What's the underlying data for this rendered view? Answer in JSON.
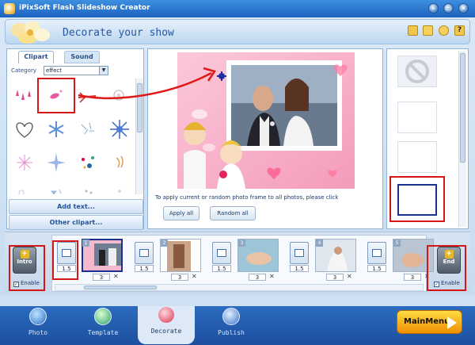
{
  "window": {
    "title": "iPixSoft Flash Slideshow Creator"
  },
  "header": {
    "title": "Decorate your show",
    "icons": [
      "folder-icon",
      "save-icon",
      "user-icon",
      "help-icon"
    ]
  },
  "left_panel": {
    "tabs": [
      {
        "label": "Clipart",
        "active": true
      },
      {
        "label": "Sound",
        "active": false
      }
    ],
    "category_label": "Category",
    "category_value": "effect",
    "clip_icons": [
      "drops-clip",
      "heart-confetti-clip",
      "arrow-clip",
      "flower-clip",
      "heart-outline-clip",
      "snowflake-clip",
      "sparkle-clip",
      "star-burst-clip",
      "firework-clip",
      "sparkle-star-clip",
      "confetti-clip",
      "leaf-clip",
      "bubbles-clip",
      "shapes-clip",
      "dots-clip",
      "drops2-clip"
    ],
    "add_text": "Add text...",
    "other_clipart": "Other clipart..."
  },
  "preview": {
    "hint": "To apply current or random photo frame  to all photos, please click",
    "apply_all": "Apply all",
    "random_all": "Random all"
  },
  "storyboard": {
    "intro": {
      "label": "Intro",
      "enable": "Enable"
    },
    "end": {
      "label": "End",
      "enable": "Enable"
    },
    "transitions": [
      "1.5",
      "1.5",
      "1.5",
      "1.5",
      "1.5"
    ],
    "slides": [
      {
        "num": "1",
        "duration": "3"
      },
      {
        "num": "2",
        "duration": "3"
      },
      {
        "num": "3",
        "duration": "3"
      },
      {
        "num": "4",
        "duration": "3"
      },
      {
        "num": "5",
        "duration": "3"
      }
    ]
  },
  "nav": {
    "items": [
      "Photo",
      "Template",
      "Decorate",
      "Publish"
    ],
    "active": "Decorate",
    "main_menu": "MainMenu"
  },
  "colors": {
    "title_bar": "#1d62c0",
    "accent": "#2557a0",
    "highlight": "#d41616",
    "frame_pink": "#f8b6cc"
  }
}
